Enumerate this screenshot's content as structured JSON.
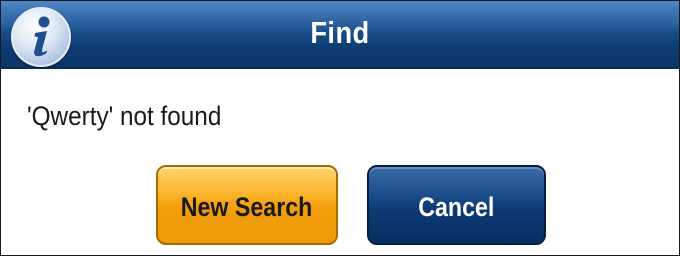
{
  "dialog": {
    "title": "Find",
    "icon": "info-icon",
    "message": "'Qwerty' not found"
  },
  "buttons": {
    "new_search_label": "New Search",
    "cancel_label": "Cancel"
  },
  "colors": {
    "title_bar": "#174b86",
    "new_search_button": "#f29d0c",
    "cancel_button": "#0c3a73",
    "title_text": "#ffffff"
  }
}
